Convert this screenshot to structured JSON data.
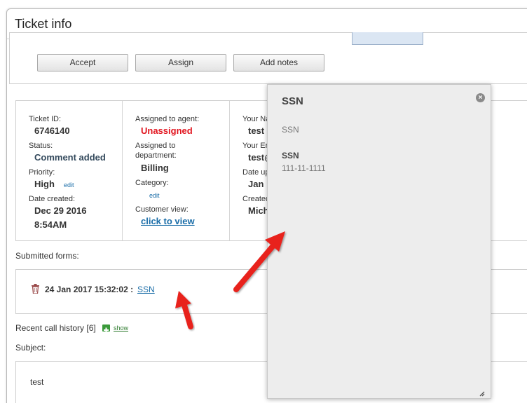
{
  "window": {
    "title": "Ticket info"
  },
  "toolbar": {
    "accept_label": "Accept",
    "assign_label": "Assign",
    "add_notes_label": "Add notes"
  },
  "ticket": {
    "id_label": "Ticket ID:",
    "id": "6746140",
    "status_label": "Status:",
    "status": "Comment added",
    "priority_label": "Priority:",
    "priority": "High",
    "priority_edit": "edit",
    "created_label": "Date created:",
    "created_date": "Dec 29 2016",
    "created_time": "8:54AM"
  },
  "assignment": {
    "agent_label": "Assigned to agent:",
    "agent": "Unassigned",
    "dept_label_1": "Assigned to",
    "dept_label_2": "department:",
    "department": "Billing",
    "category_label": "Category:",
    "category_edit": "edit",
    "customer_view_label": "Customer view:",
    "customer_view_link": "click to view"
  },
  "customer": {
    "name_label": "Your Na",
    "name": "test",
    "email_label": "Your Er",
    "email": "test@",
    "updated_label": "Date up",
    "updated": "Jan",
    "created_by_label": "Created",
    "created_by": "Mich"
  },
  "forms": {
    "section_label": "Submitted forms:",
    "entry_date": "24 Jan 2017 15:32:02 :",
    "entry_link": "SSN"
  },
  "call_history": {
    "label": "Recent call history [6]",
    "show_link": "show"
  },
  "subject": {
    "label": "Subject:",
    "value": "test"
  },
  "popup": {
    "title": "SSN",
    "subtitle": "SSN",
    "field_label": "SSN",
    "field_value": "111-11-1111"
  },
  "colors": {
    "agent_unassigned": "#e1141e",
    "link": "#1a6da8",
    "arrow": "#e8211c"
  }
}
